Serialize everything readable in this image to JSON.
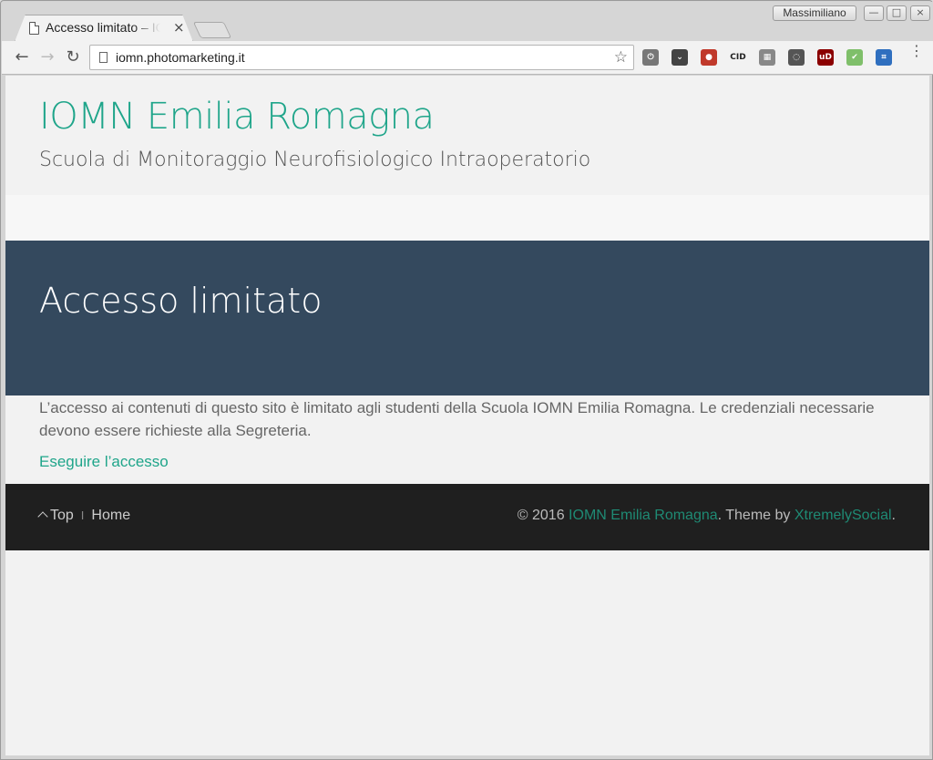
{
  "browser": {
    "tab_title": "Accesso limitato – IOMN Emilia Romagna",
    "tab_close": "×",
    "profile_name": "Massimiliano",
    "url": "iomn.photomarketing.it",
    "back_icon": "←",
    "forward_icon": "→",
    "reload_icon": "↻",
    "star_icon": "☆",
    "menu_icon": "⋮",
    "win_minimize": "—",
    "win_maximize": "□",
    "win_close": "×",
    "extensions": [
      {
        "name": "power-ext",
        "glyph": "⏻",
        "color": "#777"
      },
      {
        "name": "pocket-ext",
        "glyph": "⌄",
        "color": "#444"
      },
      {
        "name": "maps-ext",
        "glyph": "●",
        "color": "#c0392b"
      },
      {
        "name": "cid-ext",
        "glyph": "CID",
        "color": "#222"
      },
      {
        "name": "building-ext",
        "glyph": "▦",
        "color": "#888"
      },
      {
        "name": "bulb-ext",
        "glyph": "◌",
        "color": "#555"
      },
      {
        "name": "ublock-ext",
        "glyph": "uD",
        "color": "#8b0000"
      },
      {
        "name": "check-ext",
        "glyph": "✔",
        "color": "#7fbf6a"
      },
      {
        "name": "screen-ext",
        "glyph": "⌗",
        "color": "#2f6fbf"
      }
    ]
  },
  "site": {
    "title": "IOMN Emilia Romagna",
    "description": "Scuola di Monitoraggio Neurofisiologico Intraoperatorio"
  },
  "page": {
    "heading": "Accesso limitato",
    "body": "L’accesso ai contenuti di questo sito è limitato agli studenti della Scuola IOMN Emilia Romagna. Le credenziali necessarie devono essere richieste alla Segreteria.",
    "login_link": "Eseguire l’accesso"
  },
  "footer": {
    "top_label": "Top",
    "separator": "I",
    "home_label": "Home",
    "copyright_prefix": "© 2016 ",
    "site_link": "IOMN Emilia Romagna",
    "theme_text": ". Theme by ",
    "theme_link": "XtremelySocial",
    "end": "."
  },
  "colors": {
    "accent": "#1fa58a",
    "hero": "#34495e",
    "footer": "#1f1f1f"
  }
}
